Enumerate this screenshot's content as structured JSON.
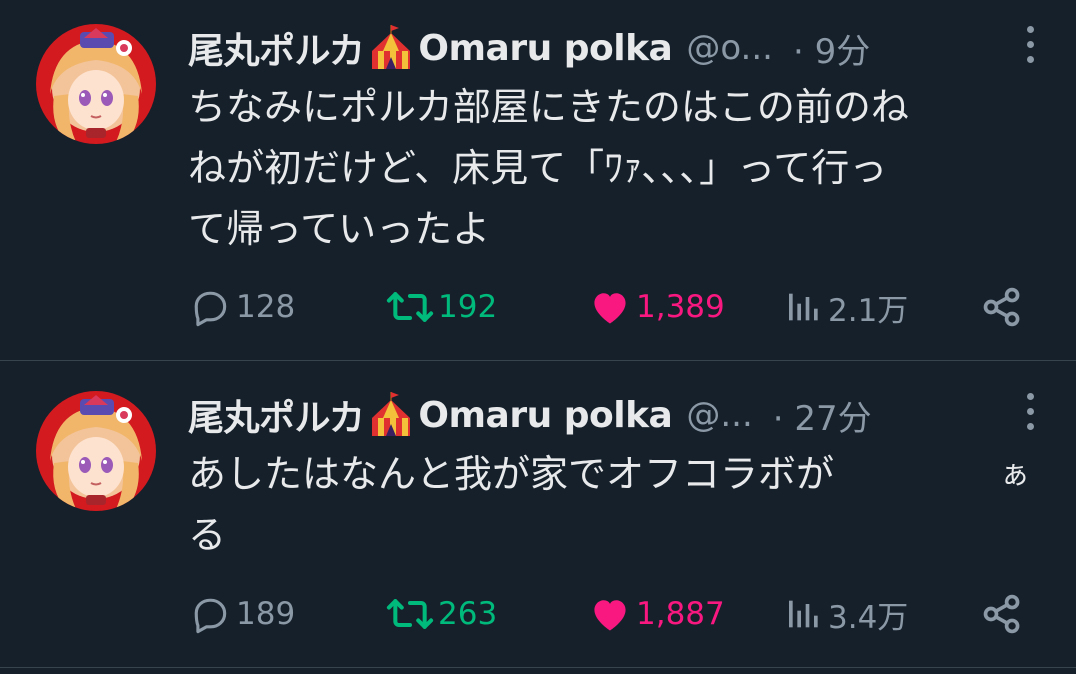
{
  "colors": {
    "background": "#15202b",
    "text_primary": "#e7e9ea",
    "text_secondary": "#8b98a5",
    "retweet_active": "#00ba7c",
    "like_active": "#f91880",
    "divider": "#38444d"
  },
  "tweets": [
    {
      "display_name": "尾丸ポルカ",
      "name_emoji": "circus-tent-icon",
      "name_suffix": "Omaru polka",
      "handle": "@o...",
      "time": "· 9分",
      "lines": [
        "ちなみにポルカ部屋にきたのはこの前のね",
        "ねが初だけど、床見て「ﾜｧ､､､」って行っ",
        "て帰っていったよ"
      ],
      "replies": "128",
      "retweets": "192",
      "likes": "1,389",
      "views": "2.1万",
      "liked": true,
      "retweeted": true
    },
    {
      "display_name": "尾丸ポルカ",
      "name_emoji": "circus-tent-icon",
      "name_suffix": "Omaru polka",
      "handle": "@...",
      "time": "· 27分",
      "lines": [
        "あしたはなんと我が家でオフコラボが",
        "る"
      ],
      "trailing_char": "ぁ",
      "replies": "189",
      "retweets": "263",
      "likes": "1,887",
      "views": "3.4万",
      "liked": true,
      "retweeted": true
    }
  ]
}
